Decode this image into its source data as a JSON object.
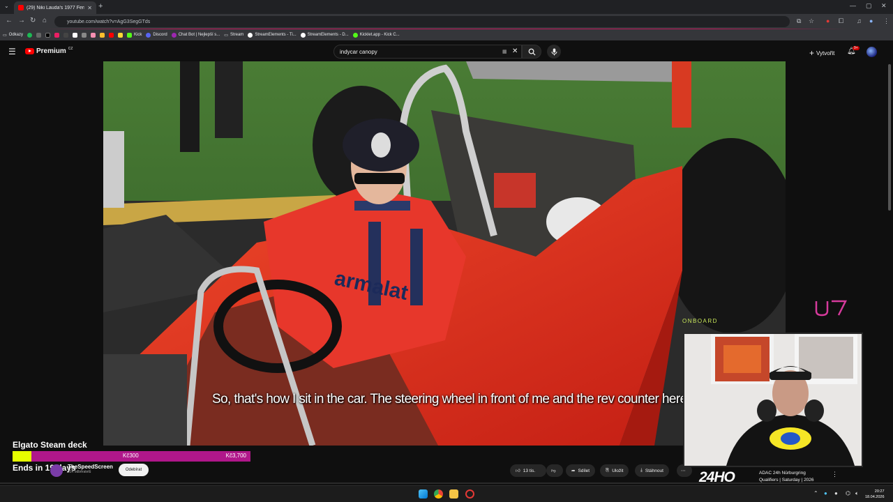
{
  "browser": {
    "tab_title": "(29) Niki Lauda's 1977 Ferrari 3...",
    "url": "youtube.com/watch?v=AgG3SegGTds",
    "bookmarks": [
      "Odkazy",
      "Kick",
      "Discord",
      "Chat Bot | Nejlepší s...",
      "Stream",
      "StreamElements - Ti...",
      "StreamElements - D...",
      "Kicklet.app - Kick C..."
    ]
  },
  "youtube": {
    "logo_text": "Premium",
    "region": "CZ",
    "search_value": "indycar canopy",
    "create_label": "Vytvořit",
    "notif_badge": "9+"
  },
  "video": {
    "subtitle": "So, that's how I sit in the car. The steering wheel in front of me and the rev counter here.",
    "car_sponsor": "armalat"
  },
  "overlay": {
    "goal_title": "Elgato Steam deck",
    "goal_current": "Kč300",
    "goal_target": "Kč3,700",
    "goal_progress": 0.08,
    "goal_ends": "Ends in 19 days",
    "onboard_label": "ONBOARD",
    "accent": "#b0178a",
    "fill_color": "#e6ff00"
  },
  "channel": {
    "name": "TheSpeedScreen",
    "subs": "514 odběratelů",
    "subscribe_label": "Odebírat"
  },
  "actions": {
    "likes": "13 tis.",
    "share": "Sdílet",
    "save": "Uložit",
    "download": "Stáhnout"
  },
  "next_video": {
    "thumb_text": "24HO",
    "title_line1": "ADAC 24h Nürburgring",
    "title_line2": "Qualifiers | Saturday | 2026"
  },
  "taskbar": {
    "time": "20:27",
    "date": "18.04.2026"
  }
}
